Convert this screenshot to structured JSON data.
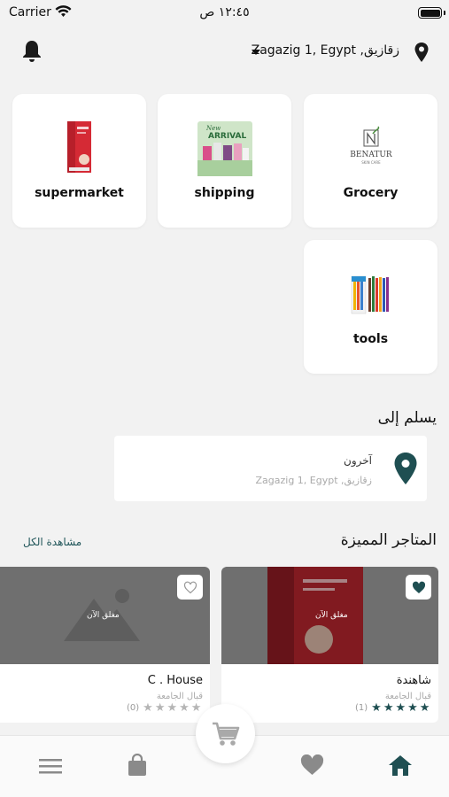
{
  "status_bar": {
    "carrier": "Carrier",
    "time": "١٢:٤٥ ص"
  },
  "header": {
    "location": "Zagazig 1, Egypt ,زقازيق"
  },
  "categories": [
    {
      "label": "supermarket"
    },
    {
      "label": "shipping"
    },
    {
      "label": "Grocery"
    },
    {
      "label": "tools"
    }
  ],
  "category_image_text": {
    "shipping_badge_top": "New",
    "shipping_badge_main": "ARRIVAL",
    "grocery_logo": "BENATUR",
    "grocery_logo_sub": "SKIN CARE"
  },
  "deliver_to": {
    "title": "يسلم إلى",
    "address_name": "آخرون",
    "address_detail": "Zagazig 1, Egypt ,زقازيق"
  },
  "featured": {
    "title": "المتاجر المميزة",
    "view_all": "مشاهدة الكل",
    "stores": [
      {
        "name": "شاهندة",
        "area": "قبال الجامعة",
        "status": "مغلق الآن",
        "rating": 5,
        "count": "(1)",
        "favorited": true
      },
      {
        "name": "C . House",
        "area": "قبال الجامعة",
        "status": "مغلق الآن",
        "rating": 0,
        "count": "(0)",
        "favorited": false
      }
    ]
  },
  "colors": {
    "brand": "#21565a",
    "star_filled": "#1f4f52",
    "star_empty": "#b5b5b5",
    "icon_gray": "#8a8a8a"
  },
  "icons": [
    "bell-icon",
    "location-pin-icon",
    "heart-icon",
    "cart-icon",
    "menu-icon",
    "bag-icon",
    "home-icon"
  ]
}
